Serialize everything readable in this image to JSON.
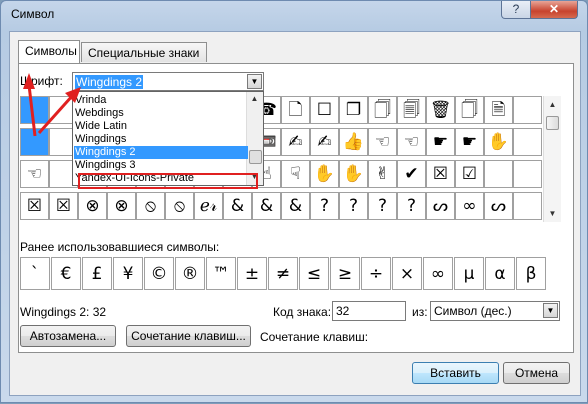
{
  "window": {
    "title": "Символ",
    "help_glyph": "?",
    "close_glyph": "✕"
  },
  "tabs": [
    {
      "label": "Символы"
    },
    {
      "label": "Специальные знаки"
    }
  ],
  "font": {
    "label": "Шрифт:",
    "value": "Wingdings 2",
    "dropdown_options": [
      "Vrinda",
      "Webdings",
      "Wide Latin",
      "Wingdings",
      "Wingdings 2",
      "Wingdings 3",
      "Yandex-UI-Icons-Private"
    ],
    "selected_option": "Wingdings 2"
  },
  "symbol_grid": {
    "rows": [
      [
        "",
        "",
        "",
        "",
        "",
        "",
        "",
        "",
        "☎",
        "🗋",
        "☐",
        "❐",
        "🗍",
        "🗐",
        "🗑",
        "🗍",
        "🗎"
      ],
      [
        "",
        "",
        "",
        "",
        "",
        "",
        "",
        "",
        "📼",
        "✍",
        "✍",
        "👍",
        "☜",
        "☜",
        "☛",
        "☛",
        "✋"
      ],
      [
        "☜",
        "",
        "",
        "",
        "",
        "",
        "",
        "",
        "☝",
        "☟",
        "✋",
        "✋",
        "✌",
        "✔",
        "☒",
        "☑"
      ],
      [
        "☒",
        "☒",
        "⊗",
        "⊗",
        "⦸",
        "⦸",
        "ℯ𝓇",
        "&",
        "&",
        "&",
        "?",
        "?",
        "?",
        "?",
        "ᔕ",
        "∞",
        "ᔕ"
      ]
    ]
  },
  "recent": {
    "label": "Ранее использовавшиеся символы:",
    "symbols": [
      "`",
      "€",
      "£",
      "¥",
      "©",
      "®",
      "™",
      "±",
      "≠",
      "≤",
      "≥",
      "÷",
      "×",
      "∞",
      "µ",
      "α",
      "β"
    ]
  },
  "char_info": {
    "name": "Wingdings 2: 32",
    "code_label": "Код знака:",
    "code_value": "32",
    "from_label": "из:",
    "from_value": "Символ (дес.)"
  },
  "buttons": {
    "autocorrect": "Автозамена...",
    "shortcut": "Сочетание клавиш...",
    "shortcut_label": "Сочетание клавиш:",
    "insert": "Вставить",
    "cancel": "Отмена"
  },
  "colors": {
    "selection": "#3399ff",
    "highlight_box": "#e02020"
  }
}
